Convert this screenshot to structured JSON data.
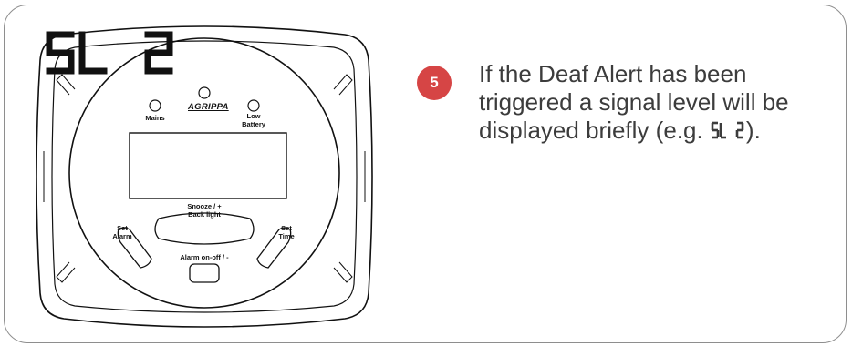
{
  "device": {
    "brand": "AGRIPPA",
    "labels": {
      "mains": "Mains",
      "low_battery_1": "Low",
      "low_battery_2": "Battery",
      "snooze_1": "Snooze / +",
      "snooze_2": "Back light",
      "set_alarm_1": "Set",
      "set_alarm_2": "Alarm",
      "set_time_1": "Set",
      "set_time_2": "Time",
      "alarm_onoff": "Alarm on-off / -"
    },
    "display_text": "SL 2"
  },
  "step": {
    "number": "5",
    "text_before": "If the Deaf Alert has been triggered a signal level will be displayed briefly (e.g. ",
    "inline_code": "SL 2",
    "text_after": ")."
  },
  "colors": {
    "badge": "#d64545",
    "text": "#3c3c3c"
  }
}
